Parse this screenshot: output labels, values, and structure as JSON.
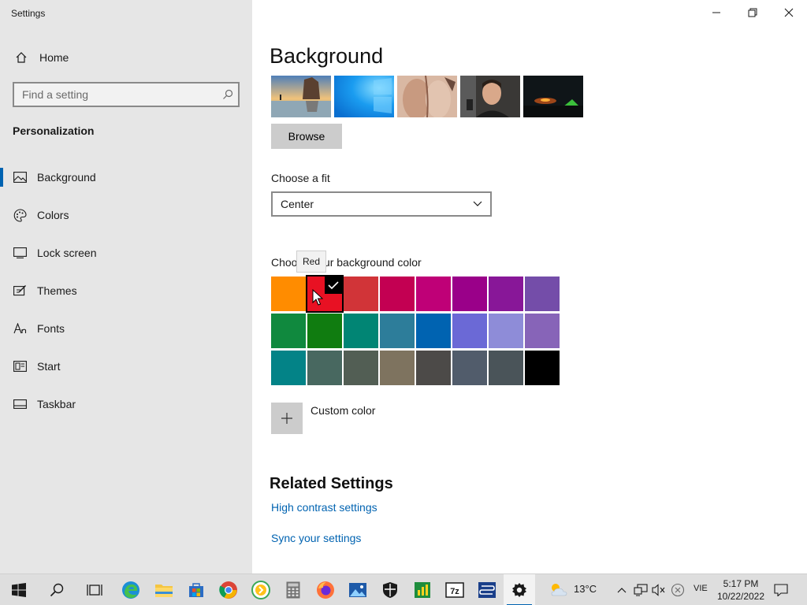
{
  "window": {
    "title": "Settings",
    "minimize_label": "Minimize",
    "maximize_label": "Restore",
    "close_label": "Close"
  },
  "sidebar": {
    "home_label": "Home",
    "search_placeholder": "Find a setting",
    "section_title": "Personalization",
    "items": [
      {
        "label": "Background",
        "icon": "image-icon",
        "active": true
      },
      {
        "label": "Colors",
        "icon": "palette-icon",
        "active": false
      },
      {
        "label": "Lock screen",
        "icon": "lock-screen-icon",
        "active": false
      },
      {
        "label": "Themes",
        "icon": "themes-icon",
        "active": false
      },
      {
        "label": "Fonts",
        "icon": "fonts-icon",
        "active": false
      },
      {
        "label": "Start",
        "icon": "start-icon",
        "active": false
      },
      {
        "label": "Taskbar",
        "icon": "taskbar-icon",
        "active": false
      }
    ]
  },
  "main": {
    "title": "Background",
    "recent_images": [
      "beach-sunset",
      "windows-blue",
      "abstract-skin",
      "man-smiling",
      "night-fire"
    ],
    "browse_label": "Browse",
    "fit_label": "Choose a fit",
    "fit_value": "Center",
    "color_label": "Choose your background color",
    "tooltip": "Red",
    "colors": [
      "#ff8c00",
      "#e81123",
      "#d13438",
      "#c30052",
      "#bf0077",
      "#9a0089",
      "#881798",
      "#744da9",
      "#10893e",
      "#107c10",
      "#018574",
      "#2d7d9a",
      "#0063b1",
      "#6b69d6",
      "#8e8cd8",
      "#8764b8",
      "#038387",
      "#486860",
      "#525e54",
      "#7e735f",
      "#4c4a48",
      "#515c6b",
      "#4a5459",
      "#000000"
    ],
    "selected_color_index": 1,
    "custom_color_label": "Custom color",
    "related_title": "Related Settings",
    "links": [
      "High contrast settings",
      "Sync your settings"
    ]
  },
  "taskbar": {
    "apps": [
      "start-icon",
      "search-icon",
      "task-view-icon",
      "edge-icon",
      "file-explorer-icon",
      "store-icon",
      "chrome-icon",
      "coccoc-icon",
      "calculator-icon",
      "firefox-icon",
      "photos-icon",
      "security-icon",
      "app-green-icon",
      "7zip-icon",
      "network-app-icon",
      "settings-icon"
    ],
    "weather_temp": "13°C",
    "language": "VIE",
    "time": "5:17 PM",
    "date": "10/22/2022"
  },
  "colors": {
    "accent": "#0063b1",
    "sidebar_bg": "#e6e6e6",
    "taskbar_bg": "#dedede"
  }
}
